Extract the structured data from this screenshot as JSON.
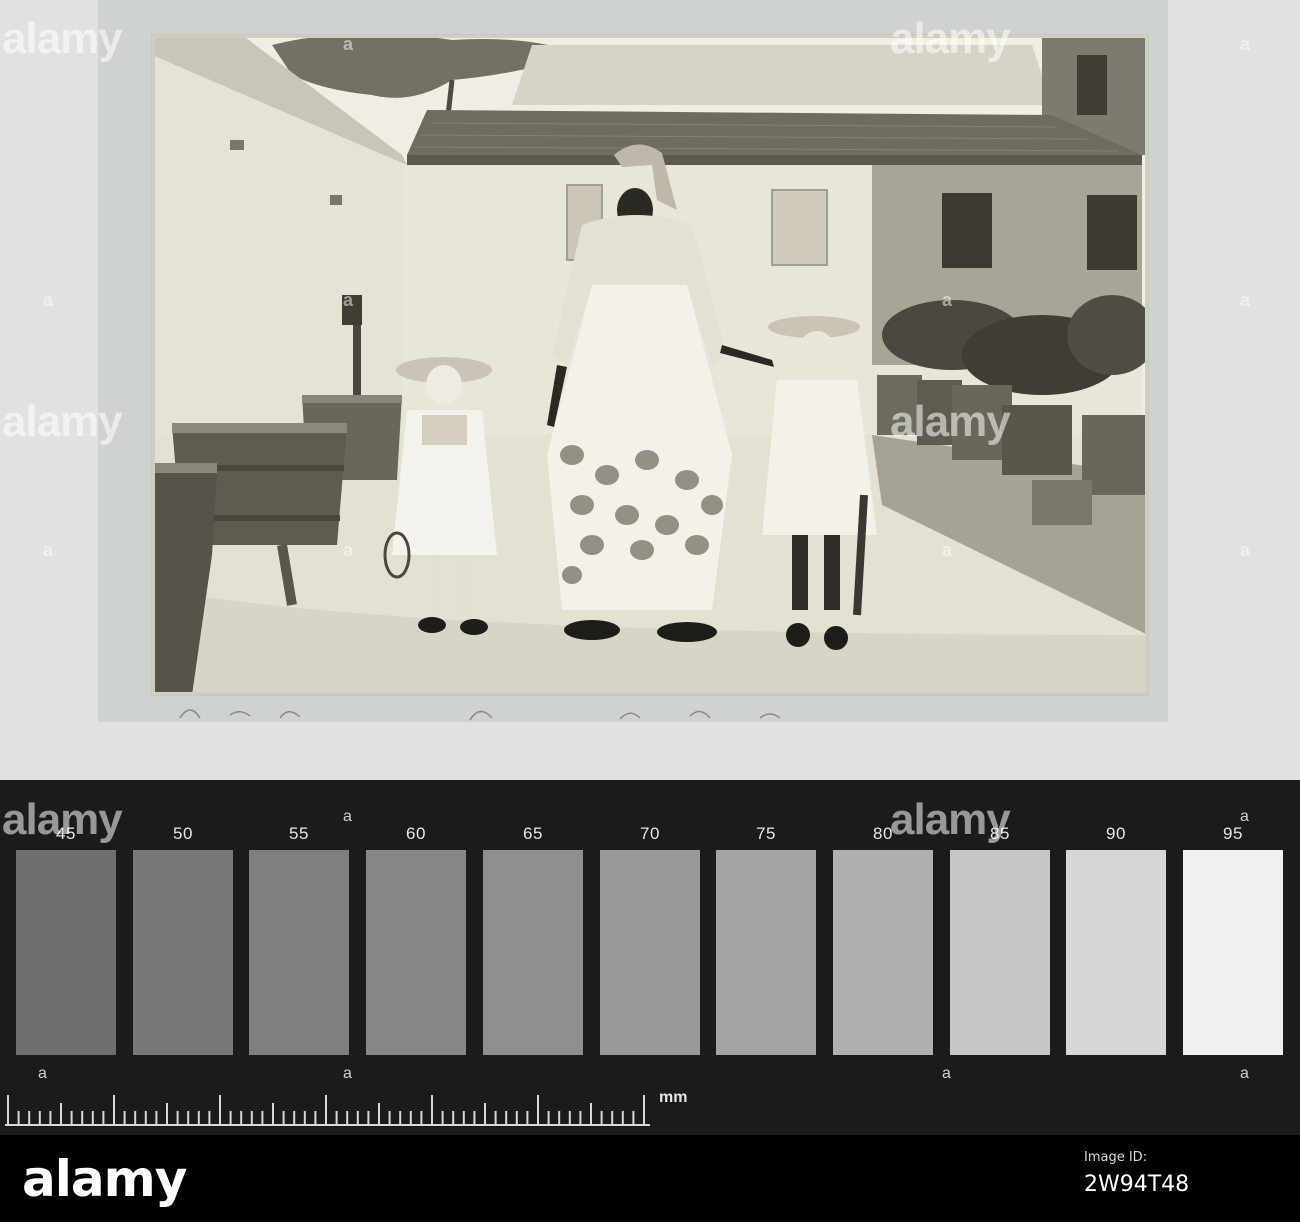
{
  "watermark": {
    "brand": "alamy",
    "small_mark": "a"
  },
  "scale": {
    "values": [
      "45",
      "50",
      "55",
      "60",
      "65",
      "70",
      "75",
      "80",
      "85",
      "90",
      "95"
    ],
    "patch_colors": [
      "#6f6f6f",
      "#777777",
      "#7f7f7f",
      "#878787",
      "#8f8f8f",
      "#999999",
      "#a4a4a4",
      "#b0b0b0",
      "#c6c6c6",
      "#d6d6d6",
      "#f0f0f0"
    ],
    "unit": "mm"
  },
  "footer": {
    "logo": "alamy",
    "image_id_caption": "Image ID:",
    "image_id": "2W94T48"
  },
  "colors": {
    "strip": "#1b1b1b",
    "album": "#cfd3d0",
    "photo_paper": "#f1efe6"
  }
}
